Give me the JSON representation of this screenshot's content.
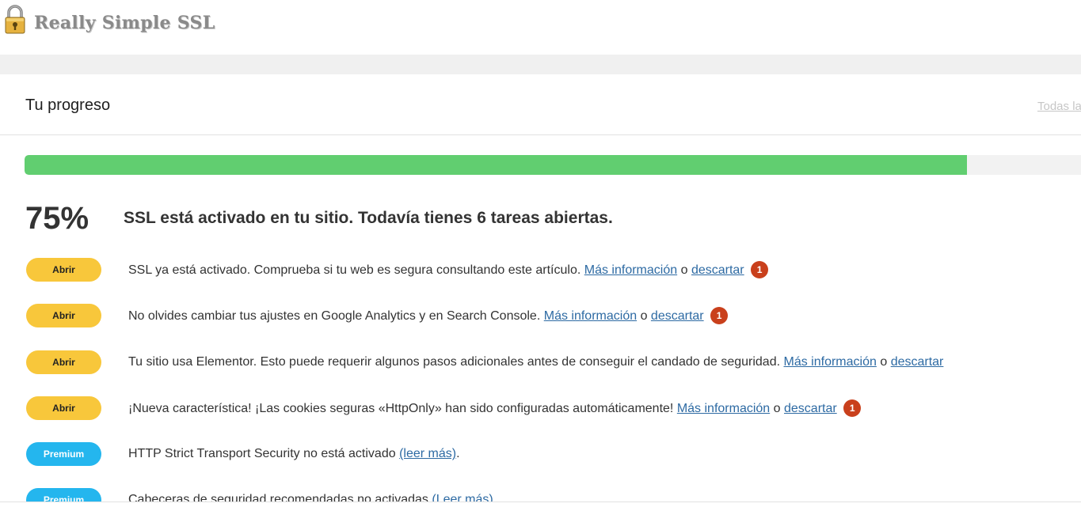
{
  "header": {
    "app_title": "Really Simple SSL",
    "logo_icon": "padlock-icon"
  },
  "progress_panel": {
    "title": "Tu progreso",
    "all_tasks_link": "Todas la",
    "progress_percent_value": 0.892,
    "percent_label": "75%",
    "summary": "SSL está activado en tu sitio. Todavía tienes 6 tareas abiertas.",
    "colors": {
      "progress_fill": "#61ce70",
      "open_badge": "#f8c73b",
      "premium_badge": "#24b6ee",
      "count_badge": "#c9401c",
      "link": "#2d6aa3"
    },
    "tasks": [
      {
        "badge": "Abrir",
        "badge_type": "open",
        "text": "SSL ya está activado. Comprueba si tu web es segura consultando este artículo.",
        "more_link": "Más información",
        "connector": "o",
        "dismiss_link": "descartar",
        "count": "1"
      },
      {
        "badge": "Abrir",
        "badge_type": "open",
        "text": "No olvides cambiar tus ajustes en Google Analytics y en Search Console.",
        "more_link": "Más información",
        "connector": "o",
        "dismiss_link": "descartar",
        "count": "1"
      },
      {
        "badge": "Abrir",
        "badge_type": "open",
        "text": "Tu sitio usa Elementor. Esto puede requerir algunos pasos adicionales antes de conseguir el candado de seguridad.",
        "more_link": "Más información",
        "connector": "o",
        "dismiss_link": "descartar",
        "count": null
      },
      {
        "badge": "Abrir",
        "badge_type": "open",
        "text": "¡Nueva característica! ¡Las cookies seguras «HttpOnly» han sido configuradas automáticamente!",
        "more_link": "Más información",
        "connector": "o",
        "dismiss_link": "descartar",
        "count": "1"
      },
      {
        "badge": "Premium",
        "badge_type": "premium",
        "text": "HTTP Strict Transport Security no está activado",
        "read_more_link": "(leer más)",
        "trailing": "."
      },
      {
        "badge": "Premium",
        "badge_type": "premium",
        "text": "Cabeceras de seguridad recomendadas no activadas",
        "read_more_link": "(Leer más)",
        "trailing": "."
      }
    ]
  }
}
